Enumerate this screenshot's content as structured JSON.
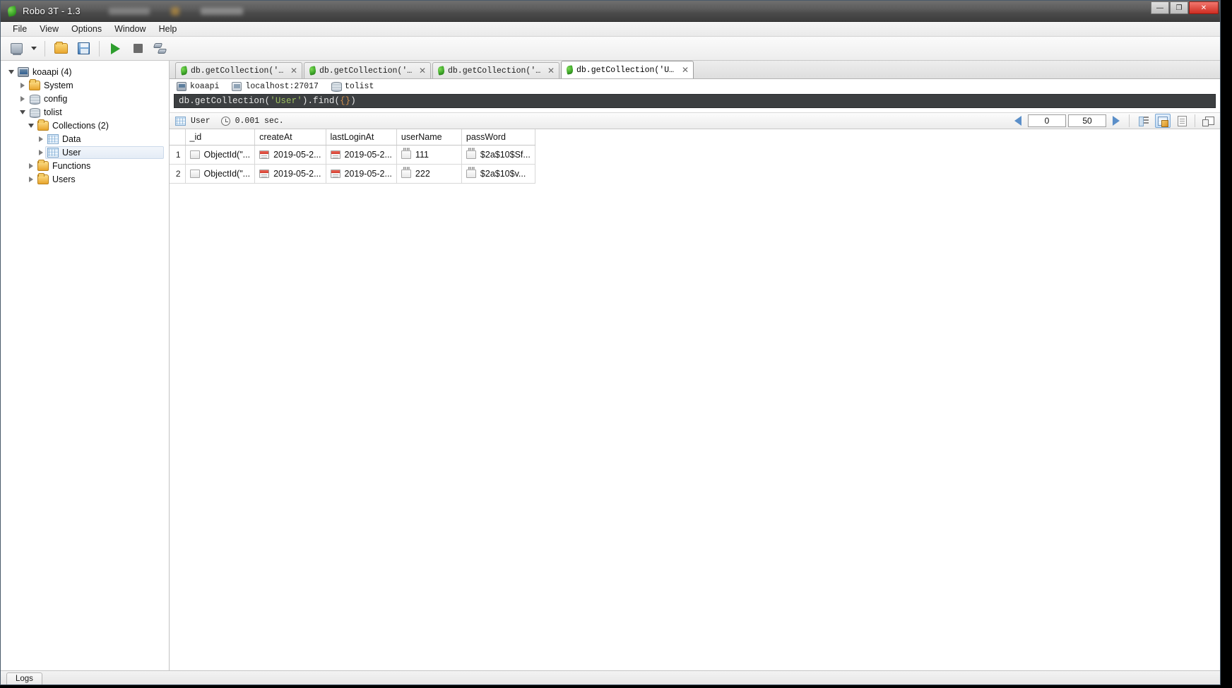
{
  "window": {
    "title": "Robo 3T - 1.3",
    "app_icon": "robomongo-leaf-icon",
    "minimize_label": "—",
    "maximize_label": "❐",
    "close_label": "✕"
  },
  "menubar": {
    "items": [
      {
        "label": "File"
      },
      {
        "label": "View"
      },
      {
        "label": "Options"
      },
      {
        "label": "Window"
      },
      {
        "label": "Help"
      }
    ]
  },
  "toolbar": {
    "buttons": [
      {
        "name": "connect-button",
        "icon": "connect-icon"
      },
      {
        "name": "connect-dropdown",
        "icon": "chevron-down-icon"
      },
      {
        "name": "open-script-button",
        "icon": "folder-open-icon"
      },
      {
        "name": "save-script-button",
        "icon": "save-icon"
      },
      {
        "name": "execute-button",
        "icon": "play-icon"
      },
      {
        "name": "stop-button",
        "icon": "stop-icon"
      },
      {
        "name": "explain-button",
        "icon": "explain-icon"
      }
    ]
  },
  "sidebar": {
    "tree": [
      {
        "label": "koaapi (4)",
        "icon": "server-icon",
        "depth": 0,
        "twisty": "open",
        "selected": false
      },
      {
        "label": "System",
        "icon": "folder-icon",
        "depth": 1,
        "twisty": "closed",
        "selected": false
      },
      {
        "label": "config",
        "icon": "database-icon",
        "depth": 1,
        "twisty": "closed",
        "selected": false
      },
      {
        "label": "tolist",
        "icon": "database-icon",
        "depth": 1,
        "twisty": "open",
        "selected": false
      },
      {
        "label": "Collections (2)",
        "icon": "folder-icon",
        "depth": 2,
        "twisty": "open",
        "selected": false
      },
      {
        "label": "Data",
        "icon": "collection-icon",
        "depth": 3,
        "twisty": "closed",
        "selected": false
      },
      {
        "label": "User",
        "icon": "collection-icon",
        "depth": 3,
        "twisty": "closed",
        "selected": true
      },
      {
        "label": "Functions",
        "icon": "folder-icon",
        "depth": 2,
        "twisty": "closed",
        "selected": false
      },
      {
        "label": "Users",
        "icon": "folder-icon",
        "depth": 2,
        "twisty": "closed",
        "selected": false
      }
    ]
  },
  "tabs": [
    {
      "label": "db.getCollection('Data').···",
      "active": false,
      "close": "✕",
      "icon": "leaf-icon"
    },
    {
      "label": "db.getCollection('User')···",
      "active": false,
      "close": "✕",
      "icon": "leaf-icon"
    },
    {
      "label": "db.getCollection('Data')···",
      "active": false,
      "close": "✕",
      "icon": "leaf-icon"
    },
    {
      "label": "db.getCollection('User').···",
      "active": true,
      "close": "✕",
      "icon": "leaf-icon"
    }
  ],
  "connection_bar": {
    "server": "koaapi",
    "host": "localhost:27017",
    "database": "tolist"
  },
  "query": {
    "prefix": "db.getCollection(",
    "string": "'User'",
    "middle": ").find(",
    "braces": "{}",
    "suffix": ")",
    "full_text": "db.getCollection('User').find({})"
  },
  "results_toolbar": {
    "collection_label": "User",
    "elapsed": "0.001 sec.",
    "skip_value": "0",
    "limit_value": "50",
    "prev_label": "◀",
    "next_label": "▶",
    "view_modes": [
      {
        "name": "tree-view-button",
        "icon": "tree-view-icon",
        "active": false
      },
      {
        "name": "table-view-button",
        "icon": "table-view-icon",
        "active": true
      },
      {
        "name": "text-view-button",
        "icon": "text-view-icon",
        "active": false
      }
    ],
    "expand_button": {
      "name": "maximize-results-button",
      "icon": "expand-icon"
    }
  },
  "grid": {
    "columns": [
      "_id",
      "createAt",
      "lastLoginAt",
      "userName",
      "passWord",
      ""
    ],
    "rows": [
      {
        "num": "1",
        "cells": [
          {
            "value": "ObjectId(\"...",
            "type": "object"
          },
          {
            "value": "2019-05-2...",
            "type": "date"
          },
          {
            "value": "2019-05-2...",
            "type": "date"
          },
          {
            "value": "111",
            "type": "string"
          },
          {
            "value": "$2a$10$Sf...",
            "type": "string"
          }
        ]
      },
      {
        "num": "2",
        "cells": [
          {
            "value": "ObjectId(\"...",
            "type": "object"
          },
          {
            "value": "2019-05-2...",
            "type": "date"
          },
          {
            "value": "2019-05-2...",
            "type": "date"
          },
          {
            "value": "222",
            "type": "string"
          },
          {
            "value": "$2a$10$v...",
            "type": "string"
          }
        ]
      }
    ]
  },
  "bottom": {
    "logs_label": "Logs"
  },
  "colors": {
    "accent_blue": "#5b8fc9",
    "editor_bg": "#3c3f41",
    "string_green": "#9dbf60",
    "brace_orange": "#d08f4e",
    "mongo_green": "#3fa82a",
    "close_red": "#cf2d22"
  }
}
